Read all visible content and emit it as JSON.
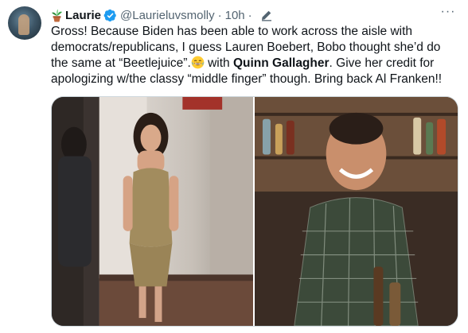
{
  "tweet": {
    "author": {
      "display_name": "Laurie",
      "handle": "@Laurieluvsmolly",
      "name_emoji_icon": "potted-plant-icon",
      "verified_icon": "verified-badge-icon",
      "avatar_icon": "avatar-photo"
    },
    "timestamp": "10h",
    "separator": "·",
    "edit_icon": "edit-pencil-icon",
    "more_icon": "more-options-icon",
    "more_glyph": "···",
    "text": {
      "line1": "Gross! Because Biden has been able to work across the aisle with",
      "line2": "democrats/republicans, I guess Lauren Boebert, Bobo thought she’d do",
      "line3_a": "the same at “Beetlejuice”.",
      "line3_emoji": "face-with-tears-of-joy-icon",
      "line3_b": " with ",
      "line3_mention": "Quinn Gallagher",
      "line3_c": ". Give her credit for",
      "line4": "apologizing w/the classy “middle finger” though. Bring back Al Franken!!"
    },
    "media": [
      {
        "name": "photo-woman-in-hallway"
      },
      {
        "name": "photo-man-at-bar"
      }
    ],
    "colors": {
      "text": "#0f1419",
      "secondary": "#536471",
      "verified": "#1d9bf0",
      "border": "#cfd9de"
    }
  }
}
